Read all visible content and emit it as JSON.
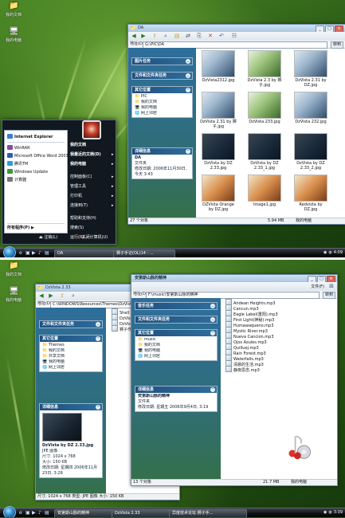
{
  "shot1": {
    "desktop_icons": [
      "我的文档",
      "我的电脑"
    ],
    "window": {
      "title": "DA",
      "address_label": "地址(D)",
      "address_value": "G:\\PIC\\DA",
      "go_label": "转到",
      "panels": {
        "picture_tasks": "图片任务",
        "file_tasks": "文件和文件夹任务",
        "other_places": "其它位置",
        "other_places_items": [
          "PIC",
          "我的文档",
          "我的电脑",
          "网上邻居"
        ],
        "details": "详细信息",
        "details_name": "DA",
        "details_type": "文件夹",
        "details_modified": "修改日期: 2006年11月30日, 今天 3:43"
      },
      "thumbnails": [
        "DzVista2312.jpg",
        "DzVista 2.3 by 狮子.jpg",
        "DzVista 2.31 by DZ.jpg",
        "DzVista 2.31 by 狮子.jpg",
        "DzVista 233.jpg",
        "DzVista 232.jpg",
        "DzVista by DZ 2.33.jpg",
        "DzVista by DZ 2.33_1.jpg",
        "DzVista by DZ 2.33_2.jpg",
        "DZVista Orange by DZ.jpg",
        "Image1.jpg",
        "Redvista by DZ.jpg"
      ],
      "status_left": "27 个对象",
      "status_size": "5.94 MB",
      "status_right": "我的电脑"
    },
    "start_menu": {
      "pinned": [
        "Internet Explorer",
        "WinRAR",
        "Microsoft Office Word 2003",
        "腾讯TM",
        "Windows Update",
        "计算器"
      ],
      "all_programs": "所有程序(P)",
      "right_items": [
        "我的文档",
        "我最近的文档(D)",
        "我的电脑",
        "控制面板(C)",
        "管理工具",
        "打印机",
        "连接到(T)",
        "帮助和支持(H)",
        "搜索(S)",
        "运行(R)..."
      ],
      "logoff": "注销(L)",
      "shutdown": "关闭计算机(U)"
    },
    "taskbar": {
      "buttons": [
        "DA",
        "狮子手记(OL)14 - ..."
      ],
      "clock": "4:09"
    }
  },
  "shot2": {
    "desktop_icons": [
      "我的文档",
      "我的电脑"
    ],
    "window_back": {
      "title": "DzVista 2.33",
      "address_label": "地址(D)",
      "address_value": "C:\\WINDOWS\\Resources\\Themes\\DzVista 2.33",
      "panels": {
        "file_tasks": "文件和文件夹任务",
        "other_places": "其它位置",
        "other_places_items": [
          "Themes",
          "我的文档",
          "共享文档",
          "我的电脑",
          "网上邻居"
        ],
        "details": "详细信息",
        "details_name": "DzVista by DZ 2.33.jpg",
        "details_type": "JPE 图像",
        "details_dims": "尺寸: 1024 x 768",
        "details_size": "大小: 150 KB",
        "details_modified": "修改日期: 星期四 2006年11月23日, 3:28"
      },
      "files": [
        "Shell",
        "DzVista 2.3...",
        "DzVista 2.3...",
        "狮子作品..."
      ],
      "status_left": "尺寸: 1024 x 768 类型: JPE 图像 大小: 150 KB"
    },
    "window_front": {
      "title": "安第斯山脉的精神",
      "menu": "文件(F)",
      "address_label": "地址(D)",
      "address_value": "F:\\music\\安第斯山脉的精神",
      "go_label": "转到",
      "panels": {
        "music_tasks": "音乐任务",
        "file_tasks": "文件和文件夹任务",
        "other_places": "其它位置",
        "other_places_items": [
          "music",
          "我的文档",
          "我的电脑",
          "网上邻居"
        ],
        "details": "详细信息",
        "details_name": "安第斯山脉的精神",
        "details_type": "文件夹",
        "details_modified": "修改日期: 星期五 2006年9月4日, 3:19"
      },
      "files": [
        "Andean Heights.mp3",
        "Cancun.mp3",
        "Eagle Label(重阳).mp3",
        "First Light(神秘).mp3",
        "Humawaqueno.mp3",
        "Mystic River.mp3",
        "Nueva Cancion.mp3",
        "Ojos Azules.mp3",
        "Quilluej.mp3",
        "Rain Forest.mp3",
        "Waterfalls.mp3",
        "清晨的生活.mp3",
        "静夜思念.mp3"
      ],
      "status_left": "13 个对象",
      "status_size": "21.7 MB",
      "status_right": "我的电脑"
    },
    "taskbar": {
      "buttons": [
        "安第斯山脉的精神",
        "DzVista 2.33",
        "异度技术论坛 狮子手..."
      ],
      "clock": "3:39"
    }
  }
}
